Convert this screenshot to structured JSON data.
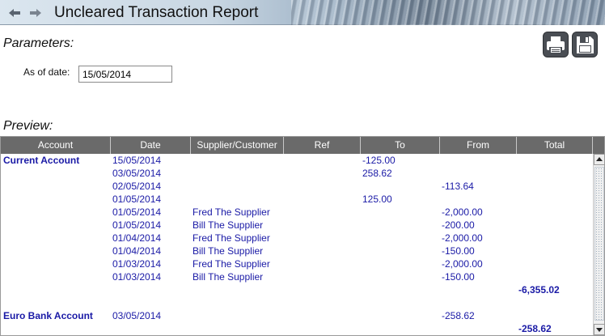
{
  "window": {
    "title": "Uncleared Transaction Report",
    "back_icon": "arrow-left-icon",
    "forward_icon": "arrow-right-icon"
  },
  "parameters": {
    "heading": "Parameters:",
    "as_of_label": "As of date:",
    "as_of_value": "15/05/2014"
  },
  "toolbar": {
    "print_icon": "printer-icon",
    "save_icon": "floppy-disk-icon"
  },
  "preview": {
    "heading": "Preview:"
  },
  "grid": {
    "columns": [
      "Account",
      "Date",
      "Supplier/Customer",
      "Ref",
      "To",
      "From",
      "Total"
    ],
    "rows": [
      {
        "account": "Current Account",
        "date": "15/05/2014",
        "party": "",
        "ref": "",
        "to": "-125.00",
        "from": "",
        "total": ""
      },
      {
        "account": "",
        "date": "03/05/2014",
        "party": "",
        "ref": "",
        "to": "258.62",
        "from": "",
        "total": ""
      },
      {
        "account": "",
        "date": "02/05/2014",
        "party": "",
        "ref": "",
        "to": "",
        "from": "-113.64",
        "total": ""
      },
      {
        "account": "",
        "date": "01/05/2014",
        "party": "",
        "ref": "",
        "to": "125.00",
        "from": "",
        "total": ""
      },
      {
        "account": "",
        "date": "01/05/2014",
        "party": "Fred The Supplier",
        "ref": "",
        "to": "",
        "from": "-2,000.00",
        "total": ""
      },
      {
        "account": "",
        "date": "01/05/2014",
        "party": "Bill The Supplier",
        "ref": "",
        "to": "",
        "from": "-200.00",
        "total": ""
      },
      {
        "account": "",
        "date": "01/04/2014",
        "party": "Fred The Supplier",
        "ref": "",
        "to": "",
        "from": "-2,000.00",
        "total": ""
      },
      {
        "account": "",
        "date": "01/04/2014",
        "party": "Bill The Supplier",
        "ref": "",
        "to": "",
        "from": "-150.00",
        "total": ""
      },
      {
        "account": "",
        "date": "01/03/2014",
        "party": "Fred The Supplier",
        "ref": "",
        "to": "",
        "from": "-2,000.00",
        "total": ""
      },
      {
        "account": "",
        "date": "01/03/2014",
        "party": "Bill The Supplier",
        "ref": "",
        "to": "",
        "from": "-150.00",
        "total": ""
      },
      {
        "account": "",
        "date": "",
        "party": "",
        "ref": "",
        "to": "",
        "from": "",
        "total": "-6,355.02"
      },
      {
        "account": "",
        "date": "",
        "party": "",
        "ref": "",
        "to": "",
        "from": "",
        "total": ""
      },
      {
        "account": "Euro Bank Account",
        "date": "03/05/2014",
        "party": "",
        "ref": "",
        "to": "",
        "from": "-258.62",
        "total": ""
      },
      {
        "account": "",
        "date": "",
        "party": "",
        "ref": "",
        "to": "",
        "from": "",
        "total": "-258.62"
      }
    ]
  },
  "scrollbar": {
    "up_icon": "scroll-up-arrow-icon",
    "down_icon": "scroll-down-arrow-icon"
  }
}
